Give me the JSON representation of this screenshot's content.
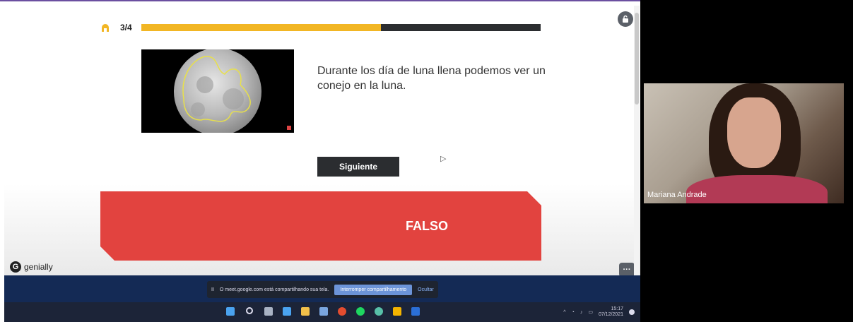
{
  "quiz": {
    "progress_label": "3/4",
    "progress_fraction": 0.6,
    "question": "Durante los día de luna llena podemos ver un conejo en la luna.",
    "next_button": "Siguiente",
    "answer": "FALSO",
    "brand": "genially",
    "more_label": "···"
  },
  "share_bar": {
    "message": "O meet.google.com está compartilhando sua tela.",
    "stop_button": "Interromper compartilhamento",
    "hide_button": "Ocultar"
  },
  "taskbar": {
    "time": "15:17",
    "date": "07/12/2021"
  },
  "meet": {
    "participant_name": "Mariana Andrade"
  },
  "colors": {
    "accent_yellow": "#f2b624",
    "dark": "#2b2d30",
    "banner_red": "#e2433f",
    "share_blue": "#142a55"
  }
}
